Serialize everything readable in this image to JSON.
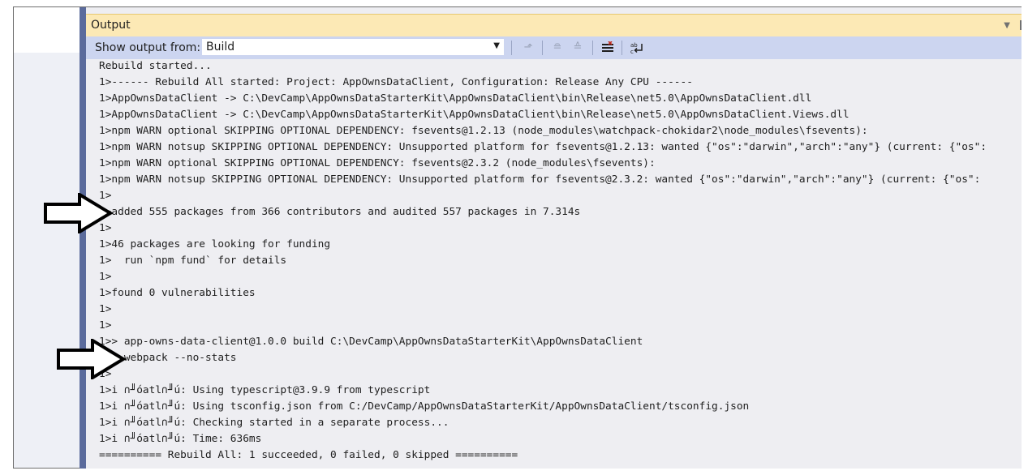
{
  "window": {
    "title": "Output"
  },
  "toolbar": {
    "show_from_label": "Show output from:",
    "source_value": "Build",
    "buttons": [
      {
        "icon": "goto-previous-message-icon",
        "glyph": "⬏"
      },
      {
        "icon": "goto-previous-icon",
        "glyph": "≡"
      },
      {
        "icon": "goto-next-icon",
        "glyph": "≡"
      },
      {
        "icon": "clear-all-icon",
        "glyph": "☰"
      },
      {
        "icon": "toggle-word-wrap-icon",
        "glyph": "↵"
      }
    ]
  },
  "output_lines": [
    "Rebuild started...",
    "1>------ Rebuild All started: Project: AppOwnsDataClient, Configuration: Release Any CPU ------",
    "1>AppOwnsDataClient -> C:\\DevCamp\\AppOwnsDataStarterKit\\AppOwnsDataClient\\bin\\Release\\net5.0\\AppOwnsDataClient.dll",
    "1>AppOwnsDataClient -> C:\\DevCamp\\AppOwnsDataStarterKit\\AppOwnsDataClient\\bin\\Release\\net5.0\\AppOwnsDataClient.Views.dll",
    "1>npm WARN optional SKIPPING OPTIONAL DEPENDENCY: fsevents@1.2.13 (node_modules\\watchpack-chokidar2\\node_modules\\fsevents):",
    "1>npm WARN notsup SKIPPING OPTIONAL DEPENDENCY: Unsupported platform for fsevents@1.2.13: wanted {\"os\":\"darwin\",\"arch\":\"any\"} (current: {\"os\":",
    "1>npm WARN optional SKIPPING OPTIONAL DEPENDENCY: fsevents@2.3.2 (node_modules\\fsevents):",
    "1>npm WARN notsup SKIPPING OPTIONAL DEPENDENCY: Unsupported platform for fsevents@2.3.2: wanted {\"os\":\"darwin\",\"arch\":\"any\"} (current: {\"os\":",
    "1>",
    "1>added 555 packages from 366 contributors and audited 557 packages in 7.314s",
    "1>",
    "1>46 packages are looking for funding",
    "1>  run `npm fund` for details",
    "1>",
    "1>found 0 vulnerabilities",
    "1>",
    "1>",
    "1>> app-owns-data-client@1.0.0 build C:\\DevCamp\\AppOwnsDataStarterKit\\AppOwnsDataClient",
    "1>> webpack --no-stats",
    "1>",
    "1>i ∩╜óatl∩╜ú: Using typescript@3.9.9 from typescript",
    "1>i ∩╜óatl∩╜ú: Using tsconfig.json from C:/DevCamp/AppOwnsDataStarterKit/AppOwnsDataClient/tsconfig.json",
    "1>i ∩╜óatl∩╜ú: Checking started in a separate process...",
    "1>i ∩╜óatl∩╜ú: Time: 636ms",
    "========== Rebuild All: 1 succeeded, 0 failed, 0 skipped =========="
  ],
  "annotations": {
    "arrow_color": "#000000",
    "arrow_fill": "#ffffff"
  }
}
